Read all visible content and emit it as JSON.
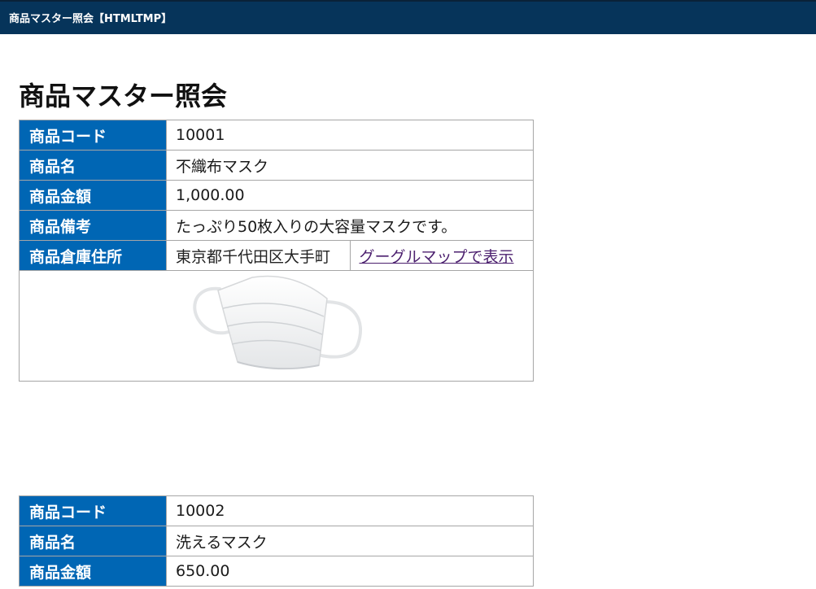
{
  "window": {
    "title": "商品マスター照会【HTMLTMP】"
  },
  "page": {
    "heading": "商品マスター照会"
  },
  "labels": {
    "code": "商品コード",
    "name": "商品名",
    "price": "商品金額",
    "note": "商品備考",
    "warehouse": "商品倉庫住所"
  },
  "products": [
    {
      "code": "10001",
      "name": "不織布マスク",
      "price": "1,000.00",
      "note": "たっぷり50枚入りの大容量マスクです。",
      "warehouse": "東京都千代田区大手町",
      "map_link": "グーグルマップで表示",
      "image": "mask-image"
    },
    {
      "code": "10002",
      "name": "洗えるマスク",
      "price": "650.00"
    }
  ],
  "colors": {
    "titlebar": "#06345a",
    "label_bg": "#0066b4",
    "link": "#4b1f6e",
    "border": "#a6a6a6"
  }
}
